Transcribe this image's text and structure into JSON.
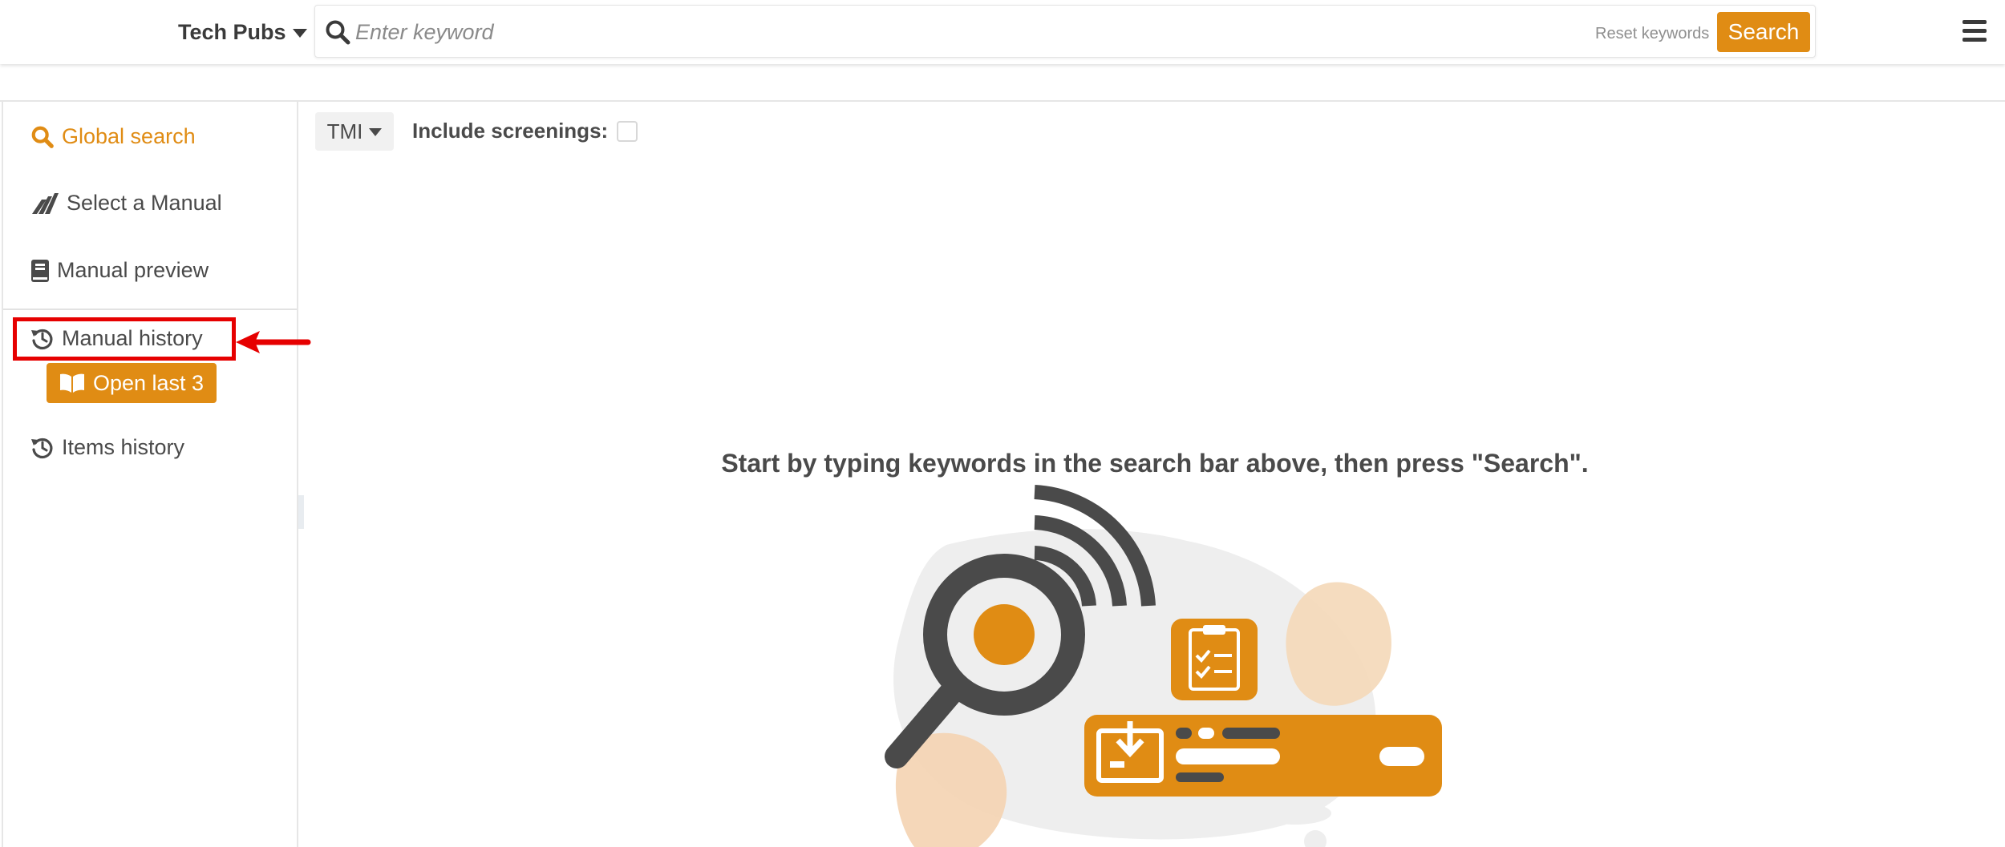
{
  "header": {
    "product_label": "Tech Pubs",
    "search": {
      "placeholder": "Enter keyword",
      "value": "",
      "reset_label": "Reset keywords",
      "button_label": "Search"
    }
  },
  "sidebar": {
    "items": [
      {
        "label": "Global search",
        "icon": "search-icon",
        "active": true
      },
      {
        "label": "Select a Manual",
        "icon": "plane-icon"
      },
      {
        "label": "Manual preview",
        "icon": "book-icon"
      },
      {
        "label": "Manual history",
        "icon": "history-icon"
      },
      {
        "label": "Items history",
        "icon": "history-icon"
      }
    ],
    "open_last_label": "Open last 3"
  },
  "main": {
    "filter_selected": "TMI",
    "include_screenings_label": "Include screenings:",
    "include_screenings_checked": false,
    "empty_message": "Start by typing keywords in the search bar above, then press \"Search\"."
  },
  "colors": {
    "accent": "#e08c14",
    "text": "#4a4a4a",
    "annotation": "#e60000"
  }
}
